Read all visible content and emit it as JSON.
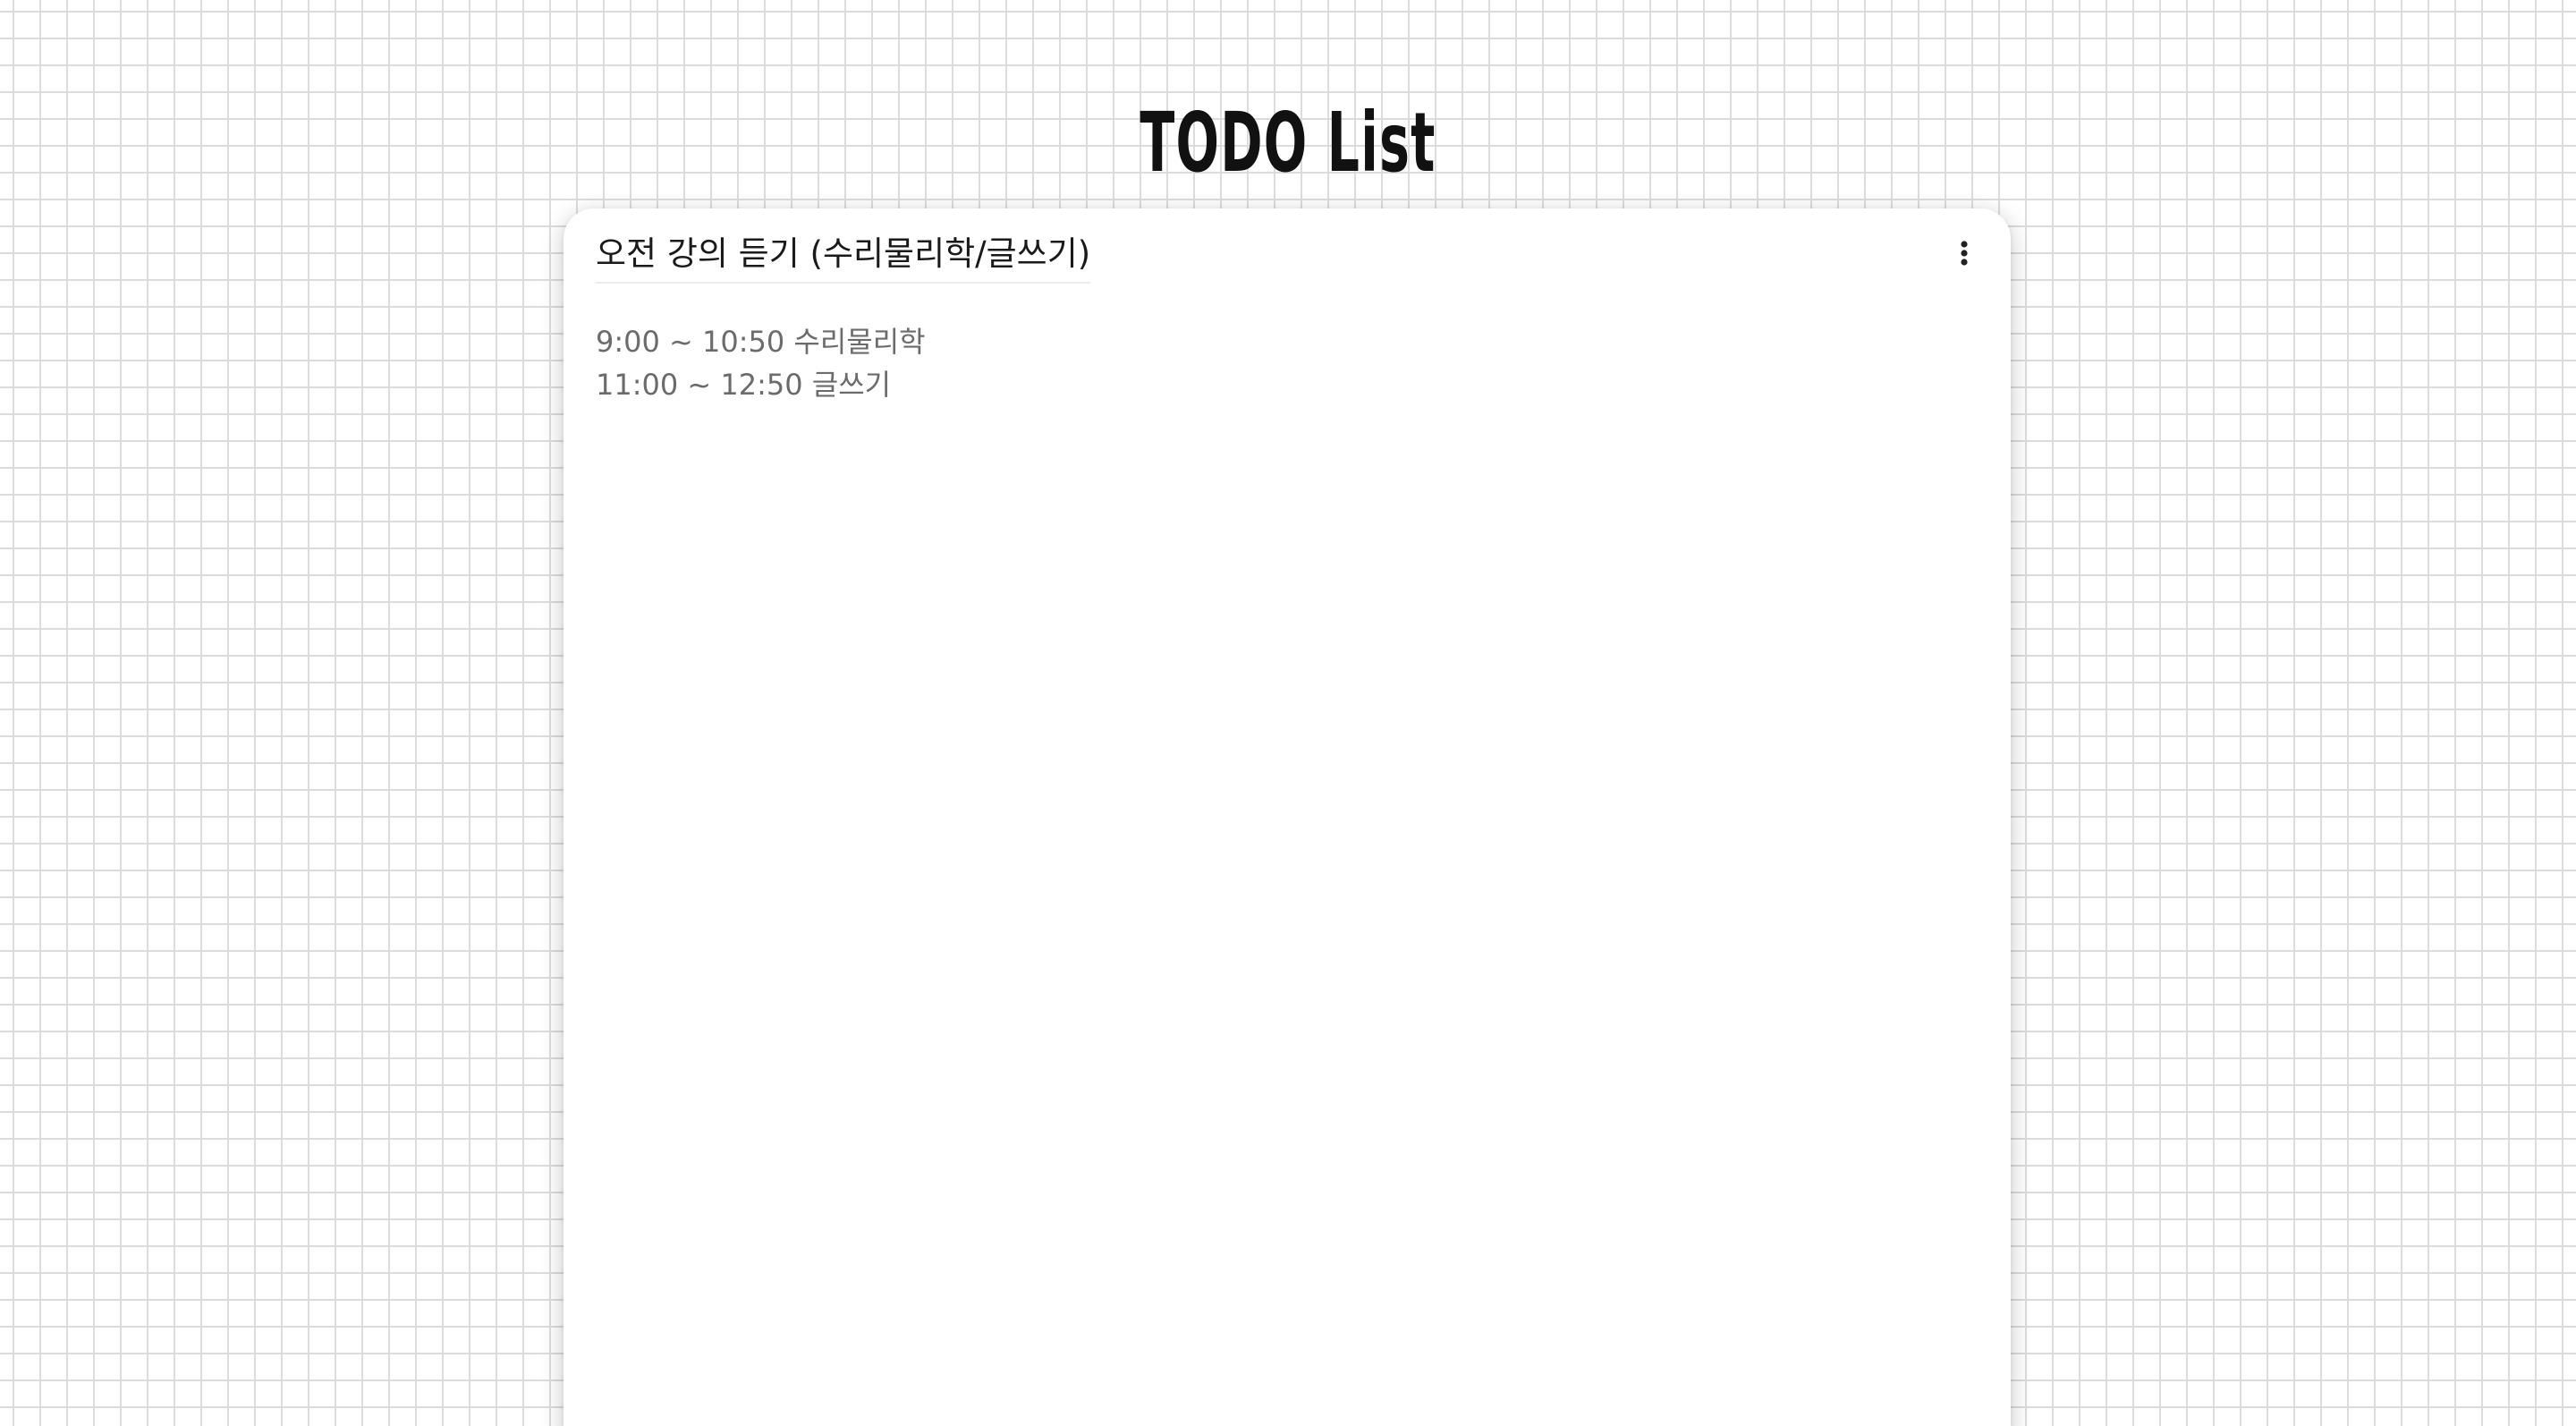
{
  "header": {
    "title": "TODO List"
  },
  "todo": {
    "title": "오전 강의 듣기 (수리물리학/글쓰기)",
    "menu_icon": "more-vertical-icon",
    "lines": [
      "9:00 ~ 10:50 수리물리학",
      "11:00 ~ 12:50 글쓰기"
    ]
  },
  "colors": {
    "background": "#ffffff",
    "grid_line": "#dcdcdc",
    "card": "#ffffff",
    "title_text": "#111111",
    "body_text": "#6b6b6b"
  }
}
